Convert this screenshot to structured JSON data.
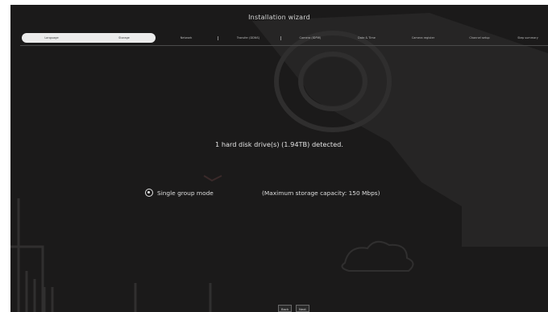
{
  "window": {
    "title": "Installation wizard"
  },
  "steps": [
    {
      "label": "Language",
      "active": true
    },
    {
      "label": "Storage",
      "active": true
    },
    {
      "label": "Network",
      "active": false
    },
    {
      "label": "Transfer (DDNS)",
      "active": false
    },
    {
      "label": "Camera (IDPW)",
      "active": false
    },
    {
      "label": "Date & Time",
      "active": false
    },
    {
      "label": "Camera register",
      "active": false
    },
    {
      "label": "Channel setup",
      "active": false
    },
    {
      "label": "Step summary",
      "active": false
    }
  ],
  "main": {
    "detect_message": "1 hard disk drive(s) (1.94TB) detected.",
    "mode_option": {
      "label": "Single group mode",
      "selected": true
    },
    "capacity_text": "(Maximum storage capacity: 150 Mbps)"
  },
  "footer": {
    "back_label": "Back",
    "next_label": "Next"
  },
  "colors": {
    "panel_bg": "#1b1a1a",
    "text": "#e2e2e2",
    "active_step_bg": "#ececec"
  },
  "icons": {
    "radio": "radio-selected-icon"
  }
}
